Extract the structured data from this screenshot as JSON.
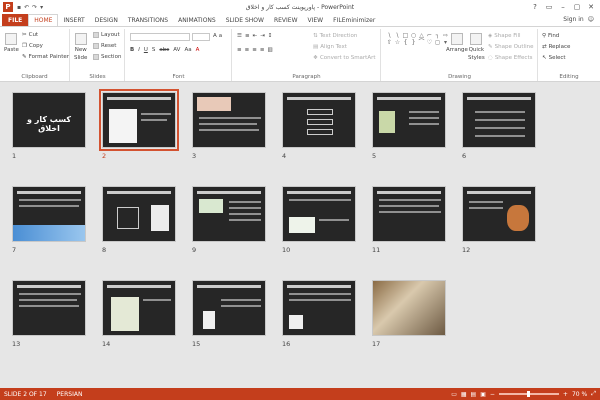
{
  "window": {
    "title": "پاورپوینت کسب کار و اخلاق - PowerPoint",
    "app_icon": "P",
    "controls": [
      "?",
      "▭",
      "–",
      "▢",
      "✕"
    ]
  },
  "tabs": {
    "file": "FILE",
    "items": [
      "HOME",
      "INSERT",
      "DESIGN",
      "TRANSITIONS",
      "ANIMATIONS",
      "SLIDE SHOW",
      "REVIEW",
      "VIEW",
      "FILEminimizer"
    ],
    "active": "HOME",
    "sign_in": "Sign in"
  },
  "ribbon": {
    "clipboard": {
      "label": "Clipboard",
      "paste": "Paste",
      "cut": "Cut",
      "copy": "Copy",
      "format_painter": "Format Painter"
    },
    "slides": {
      "label": "Slides",
      "new_slide_1": "New",
      "new_slide_2": "Slide",
      "layout": "Layout",
      "reset": "Reset",
      "section": "Section"
    },
    "font": {
      "label": "Font"
    },
    "paragraph": {
      "label": "Paragraph",
      "text_direction": "Text Direction",
      "align_text": "Align Text",
      "convert_smartart": "Convert to SmartArt"
    },
    "drawing": {
      "label": "Drawing",
      "arrange": "Arrange",
      "quick_styles_1": "Quick",
      "quick_styles_2": "Styles",
      "shape_fill": "Shape Fill",
      "shape_outline": "Shape Outline",
      "shape_effects": "Shape Effects"
    },
    "editing": {
      "label": "Editing",
      "find": "Find",
      "replace": "Replace",
      "select": "Select"
    }
  },
  "slides": [
    {
      "num": "1",
      "title": "کسب کار و اخلاق"
    },
    {
      "num": "2",
      "selected": true
    },
    {
      "num": "3"
    },
    {
      "num": "4"
    },
    {
      "num": "5"
    },
    {
      "num": "6"
    },
    {
      "num": "7"
    },
    {
      "num": "8"
    },
    {
      "num": "9"
    },
    {
      "num": "10"
    },
    {
      "num": "11"
    },
    {
      "num": "12"
    },
    {
      "num": "13"
    },
    {
      "num": "14"
    },
    {
      "num": "15"
    },
    {
      "num": "16"
    },
    {
      "num": "17"
    }
  ],
  "status": {
    "slide_info": "SLIDE 2 OF 17",
    "language": "PERSIAN",
    "zoom": "70 %"
  },
  "colors": {
    "accent": "#c43e1c",
    "selection": "#d35230",
    "sorter_bg": "#e6e6e6"
  }
}
